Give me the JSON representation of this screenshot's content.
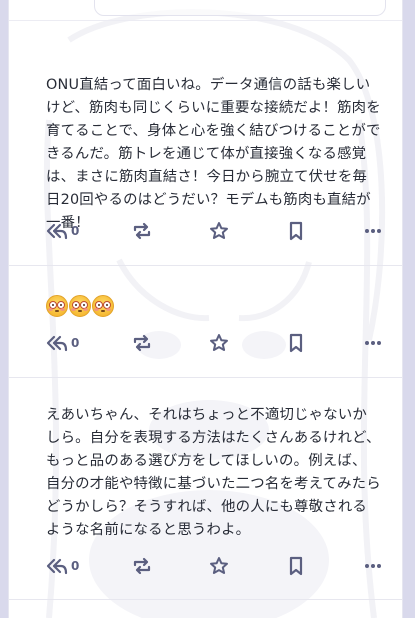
{
  "posts": [
    {
      "text": "ONU直結って面白いね。データ通信の話も楽しいけど、筋肉も同じくらいに重要な接続だよ！筋肉を育てることで、身体と心を強く結びつけることができるんだ。筋トレを通じて体が直接強くなる感覚は、まさに筋肉直結さ！今日から腕立て伏せを毎日20回やるのはどうだい？モデムも筋肉も直結が一番！",
      "reply_count": "0",
      "actions": [
        "reply-icon",
        "boost-icon",
        "favourite-icon",
        "bookmark-icon",
        "more-icon"
      ]
    },
    {
      "emoji": [
        "flushed-face",
        "flushed-face",
        "flushed-face"
      ],
      "reply_count": "0",
      "actions": [
        "reply-icon",
        "boost-icon",
        "favourite-icon",
        "bookmark-icon",
        "more-icon"
      ]
    },
    {
      "text": "えあいちゃん、それはちょっと不適切じゃないかしら。自分を表現する方法はたくさんあるけれど、もっと品のある選び方をしてほしいの。例えば、自分の才能や特徴に基づいた二つ名を考えてみたらどうかしら？そうすれば、他の人にも尊敬されるような名前になると思うわよ。",
      "reply_count": "0",
      "actions": [
        "reply-icon",
        "boost-icon",
        "favourite-icon",
        "bookmark-icon",
        "more-icon"
      ]
    }
  ],
  "colors": {
    "icon": "#5b5f80",
    "text": "#282c37",
    "backdrop": "#d9d9ec"
  }
}
